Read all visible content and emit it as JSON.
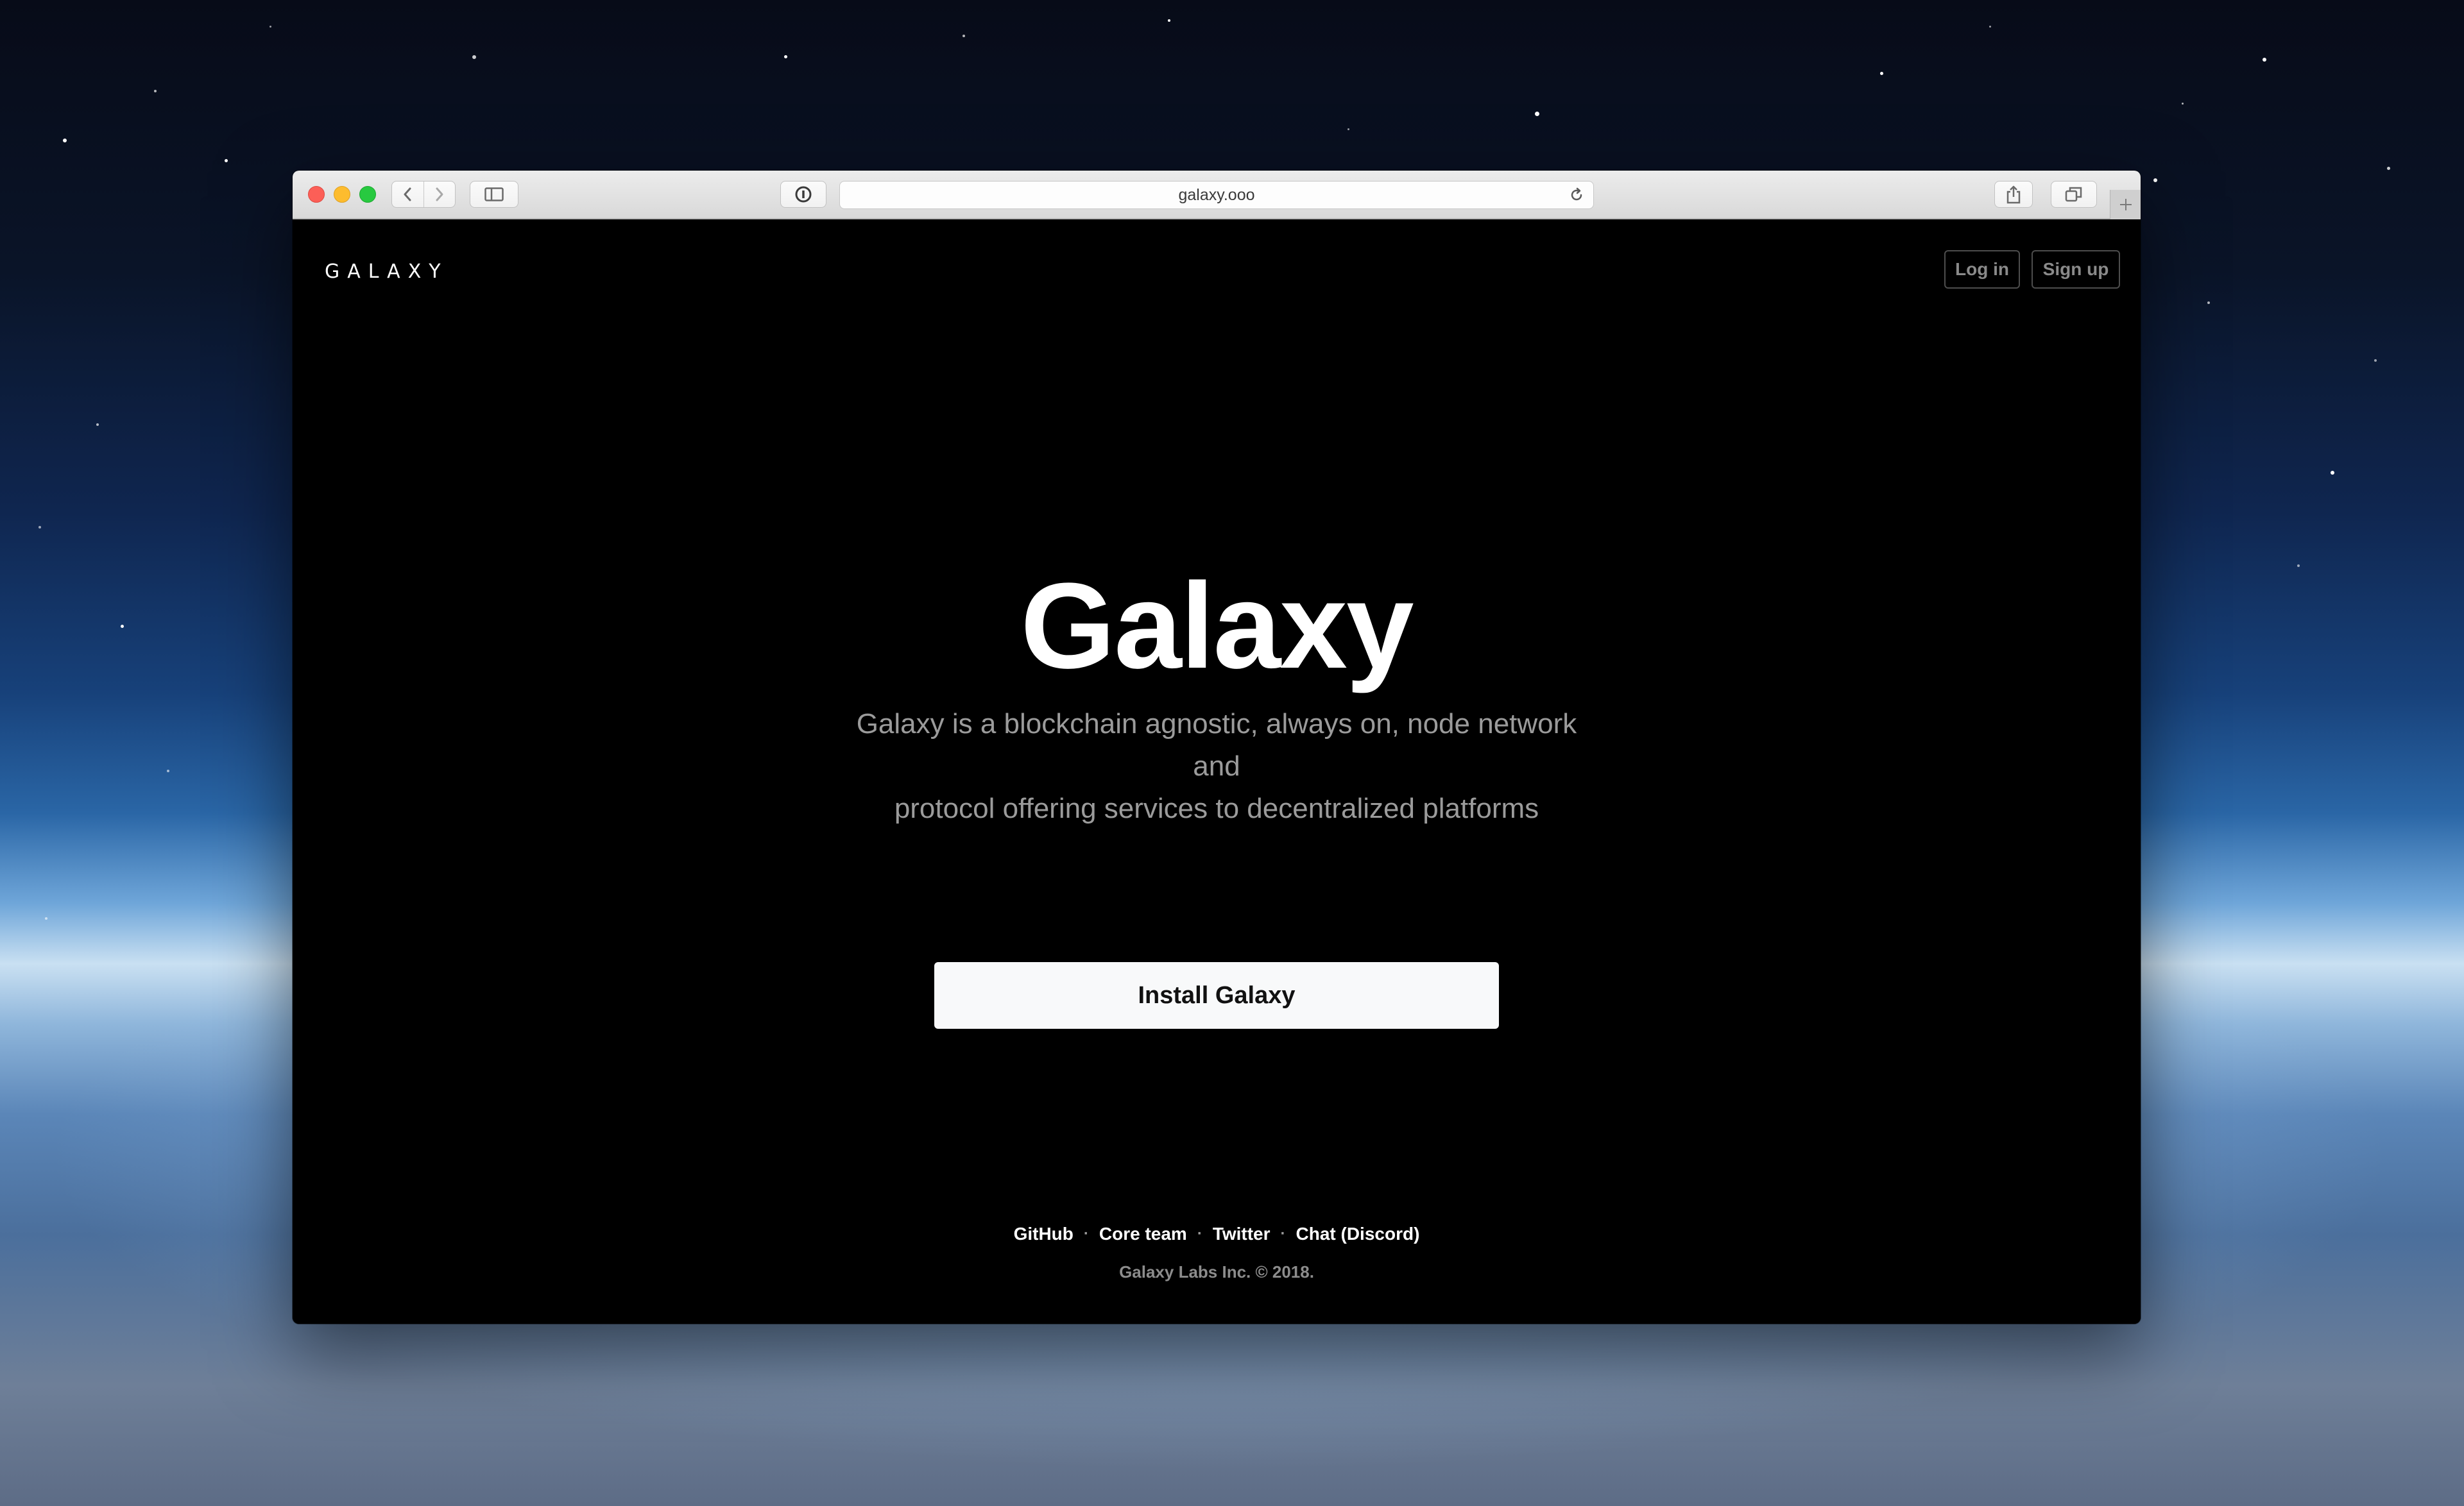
{
  "browser": {
    "url": "galaxy.ooo",
    "icons": {
      "close": "close-icon",
      "minimize": "minimize-icon",
      "maximize": "maximize-icon",
      "back": "chevron-left-icon",
      "forward": "chevron-right-icon",
      "sidebar": "sidebar-icon",
      "reader": "reader-icon",
      "reload": "reload-icon",
      "share": "share-icon",
      "tabs": "tabs-icon",
      "new_tab": "plus-icon"
    }
  },
  "page": {
    "logo": "GALAXY",
    "header": {
      "login_label": "Log in",
      "signup_label": "Sign up"
    },
    "hero": {
      "title": "Galaxy",
      "subtitle_line1": "Galaxy is a blockchain agnostic, always on, node network and",
      "subtitle_line2": "protocol offering services to decentralized platforms",
      "cta_label": "Install Galaxy"
    },
    "footer": {
      "links": [
        "GitHub",
        "Core team",
        "Twitter",
        "Chat (Discord)"
      ],
      "separator": "·",
      "copyright": "Galaxy Labs Inc. © 2018."
    }
  },
  "colors": {
    "page_background": "#000000",
    "cta_background": "#f8f9fa",
    "subtitle_text": "#9b9b9b",
    "header_button_text": "#8a8a8a"
  }
}
